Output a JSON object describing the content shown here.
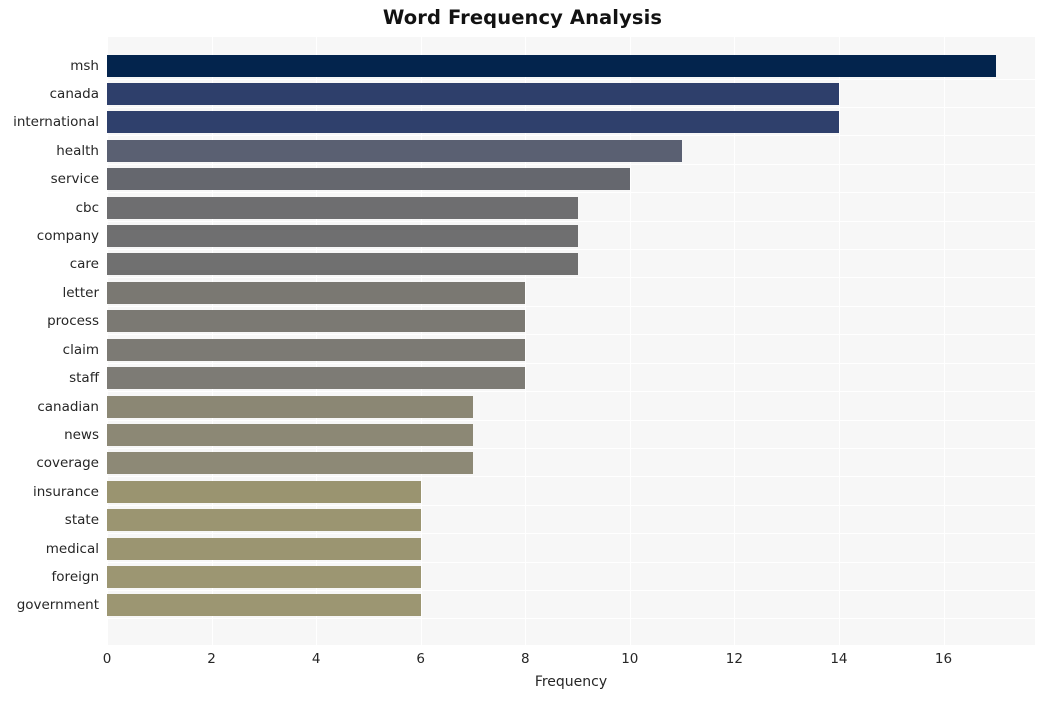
{
  "chart_data": {
    "type": "bar",
    "orientation": "horizontal",
    "title": "Word Frequency Analysis",
    "xlabel": "Frequency",
    "ylabel": "",
    "categories": [
      "msh",
      "canada",
      "international",
      "health",
      "service",
      "cbc",
      "company",
      "care",
      "letter",
      "process",
      "claim",
      "staff",
      "canadian",
      "news",
      "coverage",
      "insurance",
      "state",
      "medical",
      "foreign",
      "government"
    ],
    "values": [
      17,
      14,
      14,
      11,
      10,
      9,
      9,
      9,
      8,
      8,
      8,
      8,
      7,
      7,
      7,
      6,
      6,
      6,
      6,
      6
    ],
    "bar_colors": [
      "#03244d",
      "#2e3f६b",
      "#2f406c",
      "#5a6072",
      "#65676e",
      "#6e6e70",
      "#6f6f70",
      "#707070",
      "#7a7872",
      "#7b7973",
      "#7c7a74",
      "#7d7b75",
      "#8b8774",
      "#8c8875",
      "#8d8976",
      "#9a9470",
      "#9b9571",
      "#9b9571",
      "#9c9672",
      "#9c9672"
    ],
    "xlim": [
      0,
      17.75
    ],
    "xticks": [
      0,
      2,
      4,
      6,
      8,
      10,
      12,
      14,
      16
    ],
    "xticklabels": [
      "0",
      "2",
      "4",
      "6",
      "8",
      "10",
      "12",
      "14",
      "16"
    ],
    "grid": true,
    "grid_axis": "x",
    "legend": null,
    "plot_background": "#f7f7f7",
    "figure_background": "#ffffff",
    "title_color": "#121212",
    "tick_color": "#262626"
  }
}
